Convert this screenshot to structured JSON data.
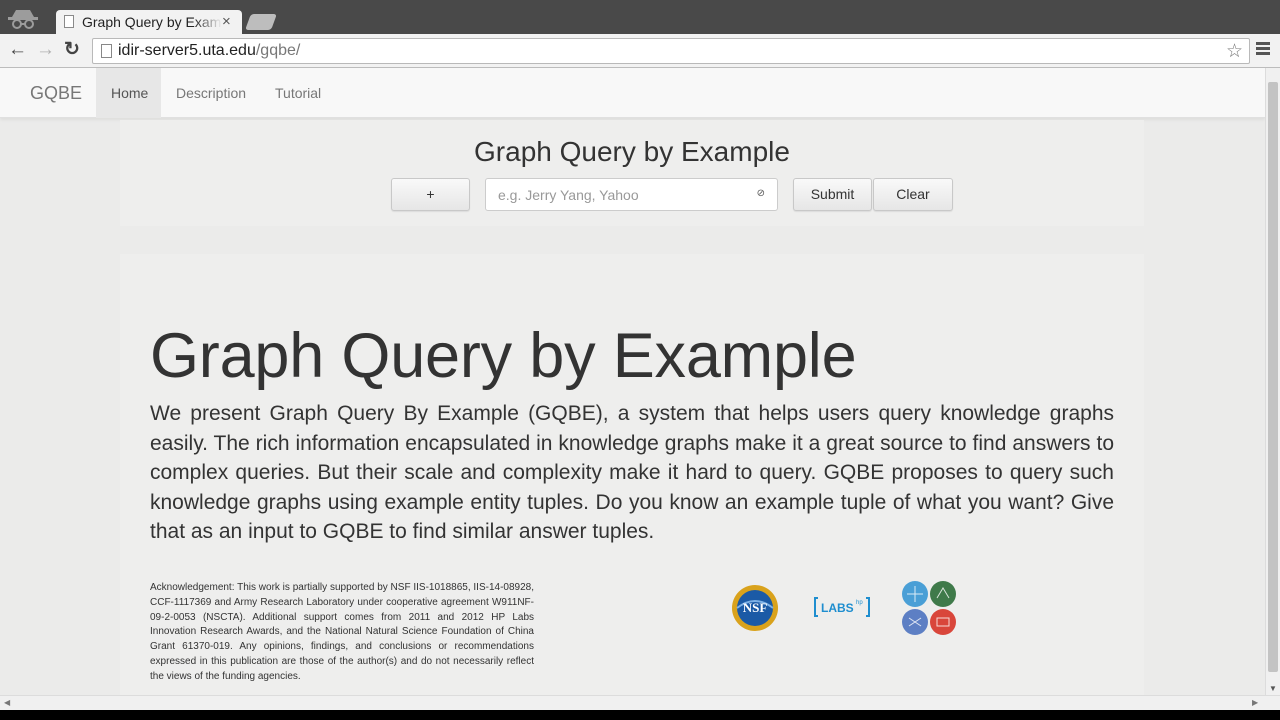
{
  "browser": {
    "tab_title": "Graph Query by Example",
    "tab_close": "×",
    "url_host": "idir-server5.uta.edu",
    "url_path": "/gqbe/",
    "back": "←",
    "forward": "→",
    "reload": "↻",
    "star": "☆"
  },
  "navbar": {
    "brand": "GQBE",
    "items": [
      {
        "label": "Home",
        "active": true
      },
      {
        "label": "Description",
        "active": false
      },
      {
        "label": "Tutorial",
        "active": false
      }
    ]
  },
  "query": {
    "title": "Graph Query by Example",
    "add_label": "+",
    "placeholder": "e.g. Jerry Yang, Yahoo",
    "clear_icon": "⊘",
    "submit_label": "Submit",
    "clear_label": "Clear"
  },
  "content": {
    "title": "Graph Query by Example",
    "description": "We present Graph Query By Example (GQBE), a system that helps users query knowledge graphs easily. The rich information encapsulated in knowledge graphs make it a great source to find answers to complex queries. But their scale and complexity make it hard to query. GQBE proposes to query such knowledge graphs using example entity tuples. Do you know an example tuple of what you want? Give that as an input to GQBE to find similar answer tuples.",
    "acknowledgement": "Acknowledgement: This work is partially supported by NSF IIS-1018865, IIS-14-08928, CCF-1117369 and Army Research Laboratory under cooperative agreement W911NF-09-2-0053 (NSCTA). Additional support comes from 2011 and 2012 HP Labs Innovation Research Awards, and the National Natural Science Foundation of China Grant 61370-019. Any opinions, findings, and conclusions or recommendations expressed in this publication are those of the author(s) and do not necessarily reflect the views of the funding agencies.",
    "logos": {
      "nsf": "NSF",
      "labs": "LABS",
      "labs_sup": "hp"
    }
  },
  "colors": {
    "page_bg": "#ebebea",
    "navbar_bg": "#f8f8f8",
    "nsf_blue": "#1b5aa6",
    "labs_blue": "#1f8ecf",
    "nsf_gold": "#d9a21c"
  }
}
